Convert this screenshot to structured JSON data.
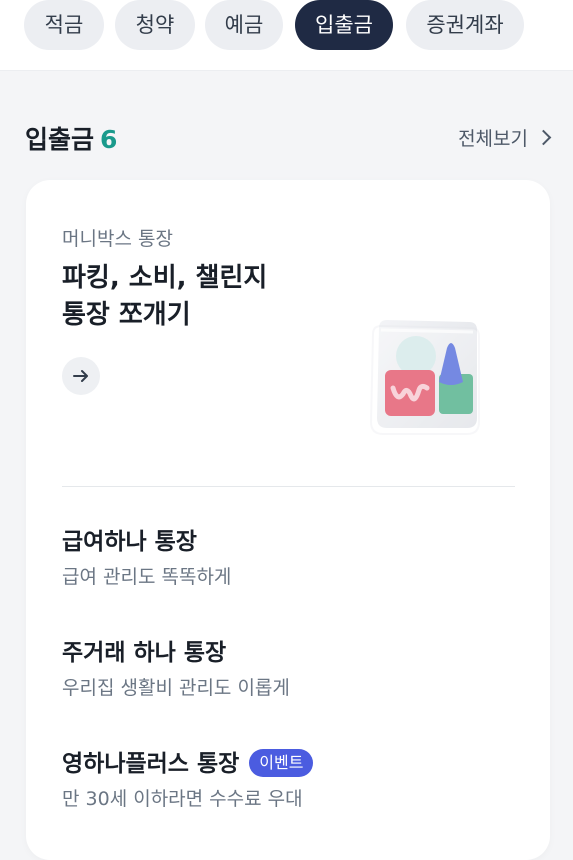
{
  "tabs": [
    {
      "label": "적금",
      "active": false
    },
    {
      "label": "청약",
      "active": false
    },
    {
      "label": "예금",
      "active": false
    },
    {
      "label": "입출금",
      "active": true
    },
    {
      "label": "증권계좌",
      "active": false
    }
  ],
  "section": {
    "title": "입출금",
    "count": "6",
    "see_all": "전체보기"
  },
  "feature": {
    "label": "머니박스 통장",
    "title": "파킹, 소비, 챌린지\n통장 쪼개기",
    "arrow_icon": "arrow-right-icon",
    "illustration": "money-box-illustration"
  },
  "products": [
    {
      "name": "급여하나 통장",
      "desc": "급여 관리도 똑똑하게",
      "badge": ""
    },
    {
      "name": "주거래 하나 통장",
      "desc": "우리집 생활비 관리도 이롭게",
      "badge": ""
    },
    {
      "name": "영하나플러스 통장",
      "desc": "만 30세 이하라면 수수료 우대",
      "badge": "이벤트"
    }
  ],
  "colors": {
    "accent": "#1a9a8c",
    "active_tab": "#1f2a44",
    "badge": "#4b5ce0"
  }
}
